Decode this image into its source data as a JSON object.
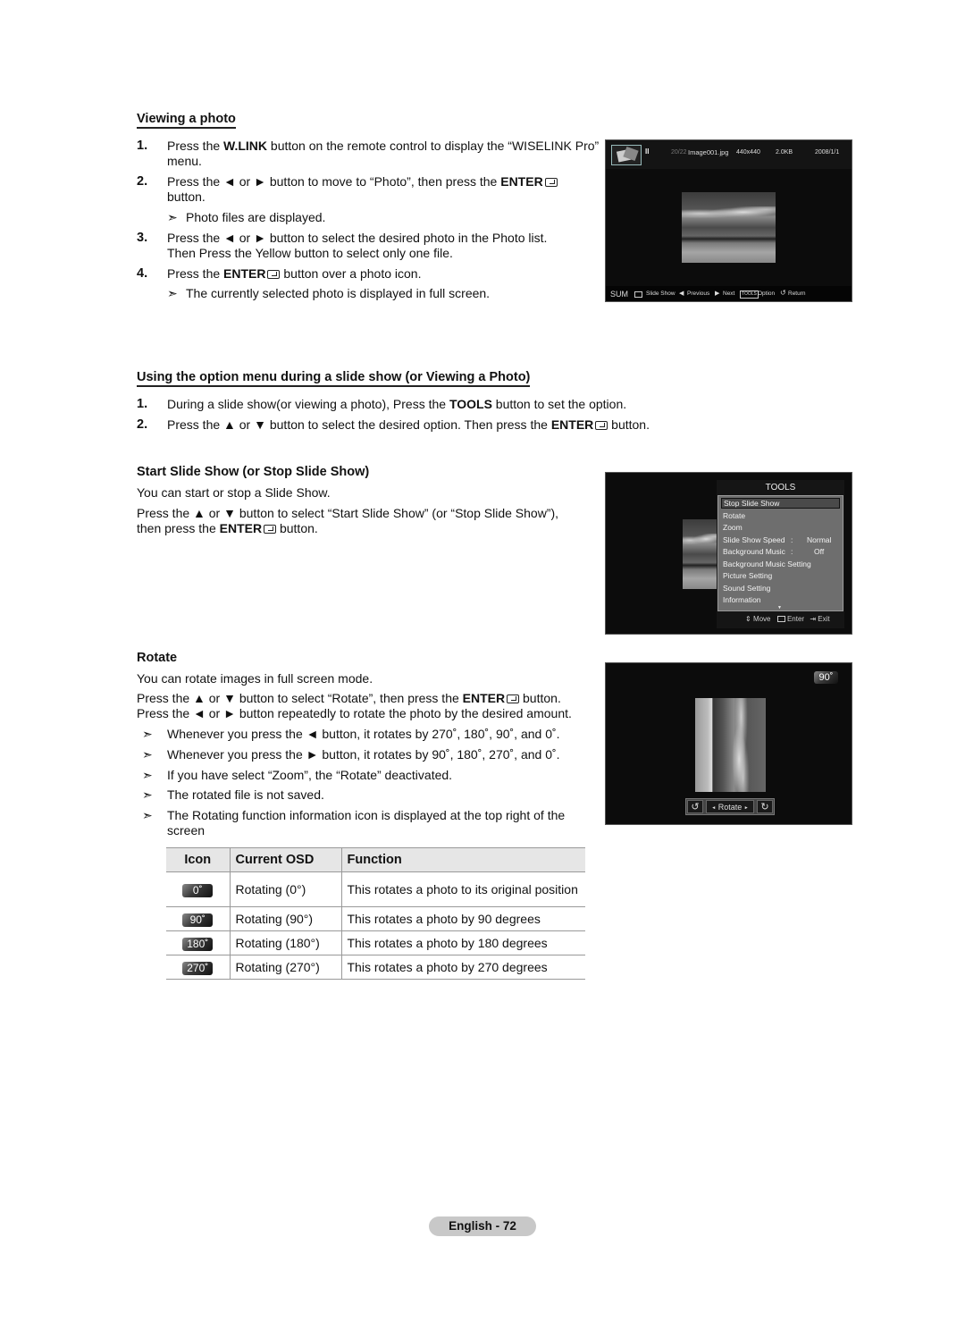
{
  "section1": {
    "heading": "Viewing a photo",
    "steps": [
      {
        "num": "1.",
        "pre": "Press the ",
        "bold": "W.LINK",
        "post": " button on the remote control to display the “WISELINK Pro” menu."
      },
      {
        "num": "2.",
        "pre": "Press the ◄ or ► button to move to “Photo”, then press the ",
        "bold": "ENTER",
        "post": " button."
      },
      {
        "num": "3.",
        "text": "Press the ◄ or ► button to select the desired photo in the Photo list. Then Press the Yellow button to select only one file."
      },
      {
        "num": "4.",
        "pre": "Press the ",
        "bold": "ENTER",
        "post": " button over a photo icon."
      }
    ],
    "notes": [
      "Photo files are displayed.",
      "The currently selected photo is displayed in full screen."
    ],
    "note_arrow": "➣"
  },
  "screen1": {
    "status_pause": "II",
    "counter": "20/22",
    "filename": "Image001.jpg",
    "resolution": "440x440",
    "filesize": "2.0KB",
    "date": "2008/1/1",
    "bottom_bar": {
      "sum": "SUM",
      "slideshow": "Slide Show",
      "previous": "Previous",
      "next": "Next",
      "tools_key": "TOOLS",
      "option": "Option",
      "return": "Return"
    }
  },
  "section2": {
    "heading": "Using the option menu during a slide show (or Viewing a Photo)",
    "steps": [
      {
        "num": "1.",
        "pre": "During a slide show(or viewing a photo), Press the ",
        "bold": "TOOLS",
        "post": " button to set the option."
      },
      {
        "num": "2.",
        "pre": "Press the ▲ or ▼ button to select the desired option. Then press the ",
        "bold": "ENTER",
        "post": " button."
      }
    ]
  },
  "slideshow": {
    "heading": "Start Slide Show (or Stop Slide Show)",
    "para1": "You can start or stop a Slide Show.",
    "para2_pre": "Press the ▲ or ▼ button to select “Start Slide Show” (or “Stop Slide Show”), then press the ",
    "para2_bold": "ENTER",
    "para2_post": " button."
  },
  "tools_menu": {
    "title": "TOOLS",
    "items": [
      {
        "label": "Stop Slide Show",
        "value": "",
        "selected": true
      },
      {
        "label": "Rotate",
        "value": ""
      },
      {
        "label": "Zoom",
        "value": ""
      },
      {
        "label": "Slide Show Speed",
        "sep": ":",
        "value": "Normal"
      },
      {
        "label": "Background Music",
        "sep": ":",
        "value": "Off"
      },
      {
        "label": "Background Music Setting",
        "value": ""
      },
      {
        "label": "Picture Setting",
        "value": ""
      },
      {
        "label": "Sound Setting",
        "value": ""
      },
      {
        "label": "Information",
        "value": ""
      }
    ],
    "more_arrow": "▼",
    "footer": {
      "move": "Move",
      "enter": "Enter",
      "exit": "Exit"
    }
  },
  "rotate": {
    "heading": "Rotate",
    "para1": "You can rotate images in full screen mode.",
    "para2_pre": "Press the ▲ or ▼ button to select “Rotate”, then press the ",
    "para2_bold": "ENTER",
    "para2_post": " button.",
    "para3": "Press the ◄ or ► button repeatedly to rotate the photo by the desired amount.",
    "notes": [
      "Whenever you press the ◄ button, it rotates by 270˚, 180˚, 90˚, and 0˚.",
      "Whenever you press the ► button, it rotates by 90˚, 180˚, 270˚, and 0˚.",
      "If you have select “Zoom”, the “Rotate” deactivated.",
      "The rotated file is not saved.",
      "The Rotating function information icon is displayed at the top right of the screen"
    ]
  },
  "screen3": {
    "badge": "90˚",
    "control_label": "Rotate",
    "left_arrow": "◄",
    "right_arrow": "►"
  },
  "table": {
    "headers": [
      "Icon",
      "Current OSD",
      "Function"
    ],
    "rows": [
      {
        "icon": "0˚",
        "osd": "Rotating (0°)",
        "function": "This rotates a photo to its original position"
      },
      {
        "icon": "90˚",
        "osd": "Rotating (90°)",
        "function": "This rotates a photo by 90 degrees"
      },
      {
        "icon": "180˚",
        "osd": "Rotating (180°)",
        "function": "This rotates a photo by 180 degrees"
      },
      {
        "icon": "270˚",
        "osd": "Rotating (270°)",
        "function": "This rotates a photo by 270 degrees"
      }
    ]
  },
  "footer": {
    "page_label": "English - 72"
  }
}
